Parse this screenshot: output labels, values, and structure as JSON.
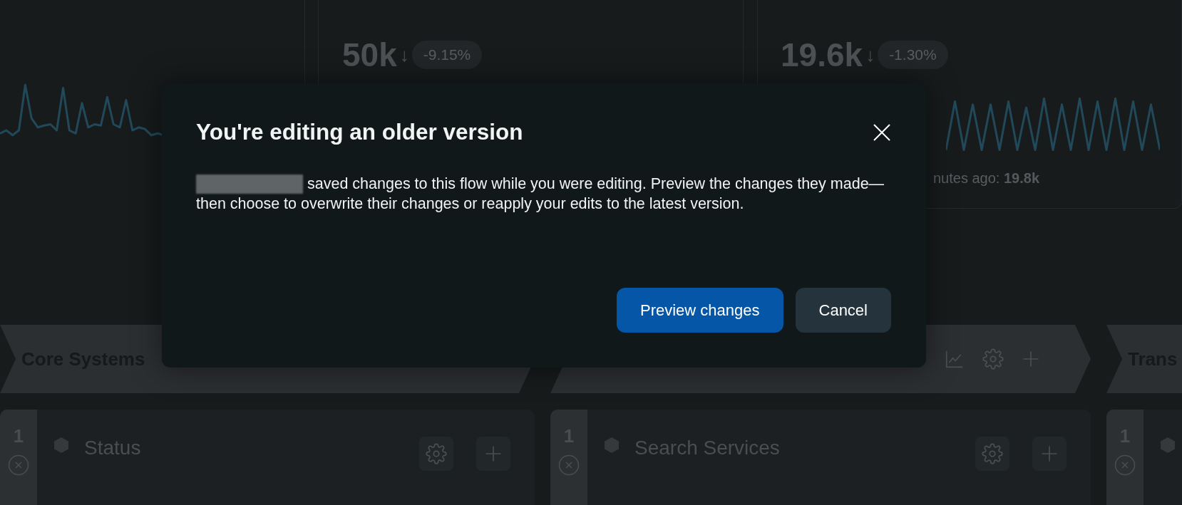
{
  "stats": [
    {
      "value": "50k",
      "trend_arrow": "↓",
      "change": "-9.15%"
    },
    {
      "value": "19.6k",
      "trend_arrow": "↓",
      "change": "-1.30%",
      "footnote_label": "nutes ago:",
      "footnote_value": "19.8k"
    }
  ],
  "lanes": [
    {
      "title": "Core Systems",
      "cards": [
        {
          "order": "1",
          "title": "Status"
        }
      ]
    },
    {
      "icons": [
        {
          "kind": "chart"
        },
        {
          "kind": "settings"
        },
        {
          "kind": "add"
        }
      ],
      "cards": [
        {
          "order": "1",
          "title": "Search Services"
        }
      ]
    },
    {
      "title": "Trans",
      "cards": [
        {
          "order": "1"
        }
      ]
    }
  ],
  "dialog": {
    "title": "You're editing an older version",
    "body": "saved changes to this flow while you were editing. Preview the changes they made—then choose to overwrite their changes or reapply your edits to the latest version.",
    "buttons": [
      {
        "label": "Preview changes",
        "kind": "primary"
      },
      {
        "label": "Cancel",
        "kind": "secondary"
      }
    ]
  }
}
